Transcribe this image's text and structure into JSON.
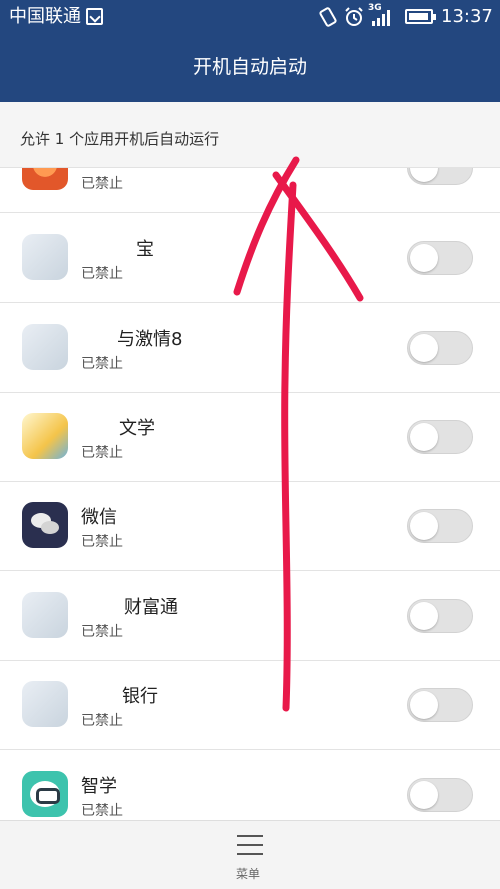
{
  "status_bar": {
    "carrier": "中国联通",
    "network": "3G",
    "time": "13:37"
  },
  "header": {
    "title": "开机自动启动"
  },
  "info": {
    "text": "允许 1 个应用开机后自动运行"
  },
  "apps": [
    {
      "name": "",
      "status": "已禁止",
      "icon": "app-icon-red",
      "enabled": false
    },
    {
      "name": "宝",
      "status": "已禁止",
      "icon": "app-icon",
      "enabled": false
    },
    {
      "name": "与激情8",
      "status": "已禁止",
      "icon": "app-icon",
      "enabled": false
    },
    {
      "name": "文学",
      "status": "已禁止",
      "icon": "app-icon-yellow",
      "enabled": false
    },
    {
      "name": "微信",
      "status": "已禁止",
      "icon": "wechat-icon",
      "enabled": false
    },
    {
      "name": "财富通",
      "status": "已禁止",
      "icon": "app-icon",
      "enabled": false
    },
    {
      "name": "银行",
      "status": "已禁止",
      "icon": "app-icon",
      "enabled": false
    },
    {
      "name": "智学",
      "status": "已禁止",
      "icon": "app-icon-teal",
      "enabled": false
    }
  ],
  "bottom_bar": {
    "menu_label": "菜单"
  },
  "colors": {
    "header_bg": "#23477f",
    "toggle_off": "#e2e2e2",
    "annotation": "#e8194a"
  }
}
